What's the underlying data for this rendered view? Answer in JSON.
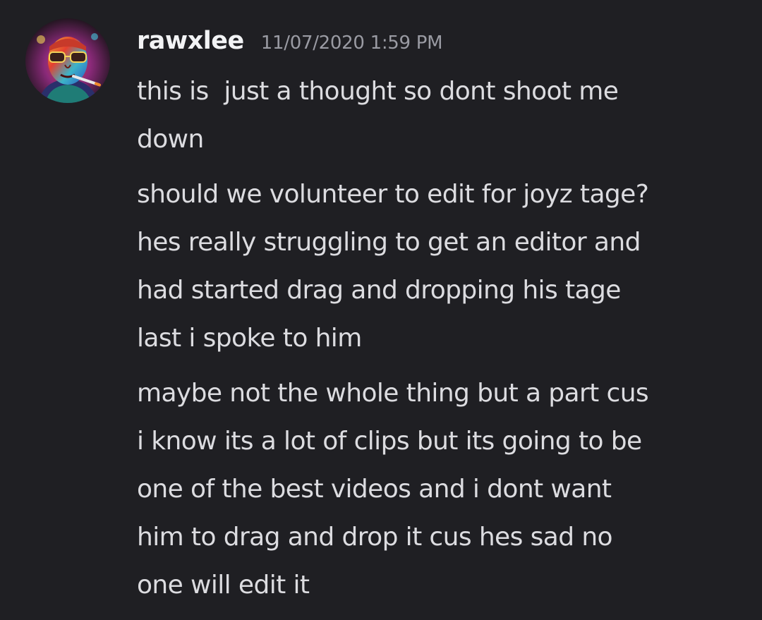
{
  "message": {
    "author": "rawxlee",
    "timestamp": "11/07/2020 1:59 PM",
    "avatar_icon": "user-avatar-icon",
    "lines": [
      "this is  just a thought so dont shoot me\ndown",
      "should we volunteer to edit for joyz tage?\nhes really struggling to get an editor and\nhad started drag and dropping his tage\nlast i spoke to him",
      "maybe not the whole thing but a part cus\ni know its a lot of clips but its going to be\none of the best videos and i dont want\nhim to drag and drop it cus hes sad no\none will edit it"
    ]
  },
  "colors": {
    "background": "#1f1f23",
    "username": "#f2f3f5",
    "timestamp": "#9a9ba3",
    "message_text": "#dcdce0"
  }
}
